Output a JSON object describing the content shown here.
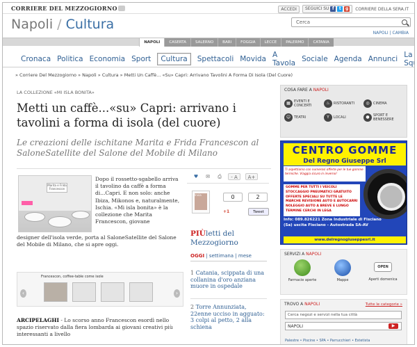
{
  "topbar": {
    "logo": "CORRIERE DEL MEZZOGIORNO",
    "accedi": "ACCEDI",
    "seguici": "SEGUICI SU",
    "corriere_sera": "CORRIERE DELLA SERA.IT"
  },
  "site": {
    "city": "Napoli",
    "sep": "/",
    "section": "Cultura"
  },
  "search": {
    "placeholder": "Cerca"
  },
  "city_switch": {
    "city": "NAPOLI",
    "change": "CAMBIA"
  },
  "regions": [
    "NAPOLI",
    "CASERTA",
    "SALERNO",
    "BARI",
    "FOGGIA",
    "LECCE",
    "PALERMO",
    "CATANIA"
  ],
  "nav": [
    "Cronaca",
    "Politica",
    "Economia",
    "Sport",
    "Cultura",
    "Spettacoli",
    "Movida",
    "A Tavola",
    "Sociale",
    "Agenda",
    "Annunci",
    "La mia Squadra"
  ],
  "breadcrumb": "» Corriere Del Mezzogiorno » Napoli » Cultura » Metti Un Caffè... «Su» Capri: Arrivano Tavolini A Forma Di Isola (Del Cuore)",
  "article": {
    "kicker": "LA COLLEZIONE «MI ISLA BONITA»",
    "headline": "Metti un caffè...«su» Capri: arrivano i tavolini a forma di isola (del cuore)",
    "subtitle": "Le creazioni delle ischitane Marita e Frida Francescon al SaloneSatellite del Salone del Mobile di Milano",
    "body1": "Dopo il rossetto-sgabello arriva il tavolino da caffè a forma di...Capri. E non solo: anche Ibiza, Mikonos e, naturalmente, Ischia. «Mi isla bonita» è la collezione che Marita Francescon, giovane",
    "body2": "designer dell'isola verde, porta al SaloneSatellite del Salone del Mobile di Milano, che si apre oggi.",
    "photo_sign": "Marita e Frida Francescon",
    "gallery_caption": "Francescon, coffee-table come isole",
    "lead_label": "ARCIPELAGHI",
    "lead_text": " - Lo scorso anno Francescon esordì nello spazio riservato dalla fiera lombarda ai giovani creativi più interessanti a livello"
  },
  "tools": {
    "font_small": "- A",
    "font_big": "A+",
    "count1": "0",
    "count2": "2",
    "gplus": "+1",
    "tweet": "Tweet",
    "share_label": "Invia"
  },
  "most_read": {
    "pi": "PIÙ",
    "rest": "letti del Mezzogiorno",
    "tab_today": "OGGI",
    "tab_week": "settimana",
    "tab_month": "mese",
    "items": [
      {
        "n": "1",
        "text": "Catania, scippata di una collanina d'oro anziana muore in ospedale"
      },
      {
        "n": "2",
        "text": "Torre Annunziata, 22enne ucciso in agguato: 3 colpi al petto, 2 alla schiena"
      }
    ]
  },
  "sidebar": {
    "cosa_fare": {
      "prefix": "COSA FARE A",
      "city": "NAPOLI"
    },
    "cosa_items": [
      "EVENTI E CONCERTI",
      "RISTORANTI",
      "CINEMA",
      "TEATRI",
      "LOCALI",
      "SPORT E BENESSERE"
    ],
    "ad": {
      "title": "CENTRO GOMME",
      "subtitle": "Del Regno Giuseppe Srl",
      "tagline": "Ti aspettiamo con numerosi offerte per le tue gomme termiche. Viaggia sicuro in inverno!",
      "list": "GOMME PER TUTTI I VEICOLI STOCCAGGIO PNEUMATICI GRATUITO OFFERTE SPECIALI SU TUTTE LE MARCHE REVISIONE AUTO E AUTOCARRI NOLEGGIO AUTO A BREVE E LUNGO TERMINE CERCHI IN LEGA",
      "info": "Info: 089.826221 Zona Industriale di Fisciano (Sa) uscita Fisciano - Autostrada SA-AV",
      "web": "www.delregnogiuseppesrl.it"
    },
    "servizi": {
      "prefix": "SERVIZI A",
      "city": "NAPOLI",
      "items": [
        "Farmacie aperte",
        "Mappe",
        "Aperti domenica"
      ],
      "open_sign": "OPEN"
    },
    "trovo": {
      "prefix": "TROVO A",
      "city": "NAPOLI",
      "all": "Tutte le categorie »",
      "placeholder": "Cerca negozi e servizi nella tua città",
      "city_value": "NAPOLI",
      "cats": "Palestre • Piscine • SPA • Parrucchieri • Estetista"
    }
  },
  "colors": {
    "link_blue": "#2f5f93",
    "accent_red": "#cc2222",
    "ad_blue": "#2246b9",
    "ad_yellow": "#fff200"
  }
}
